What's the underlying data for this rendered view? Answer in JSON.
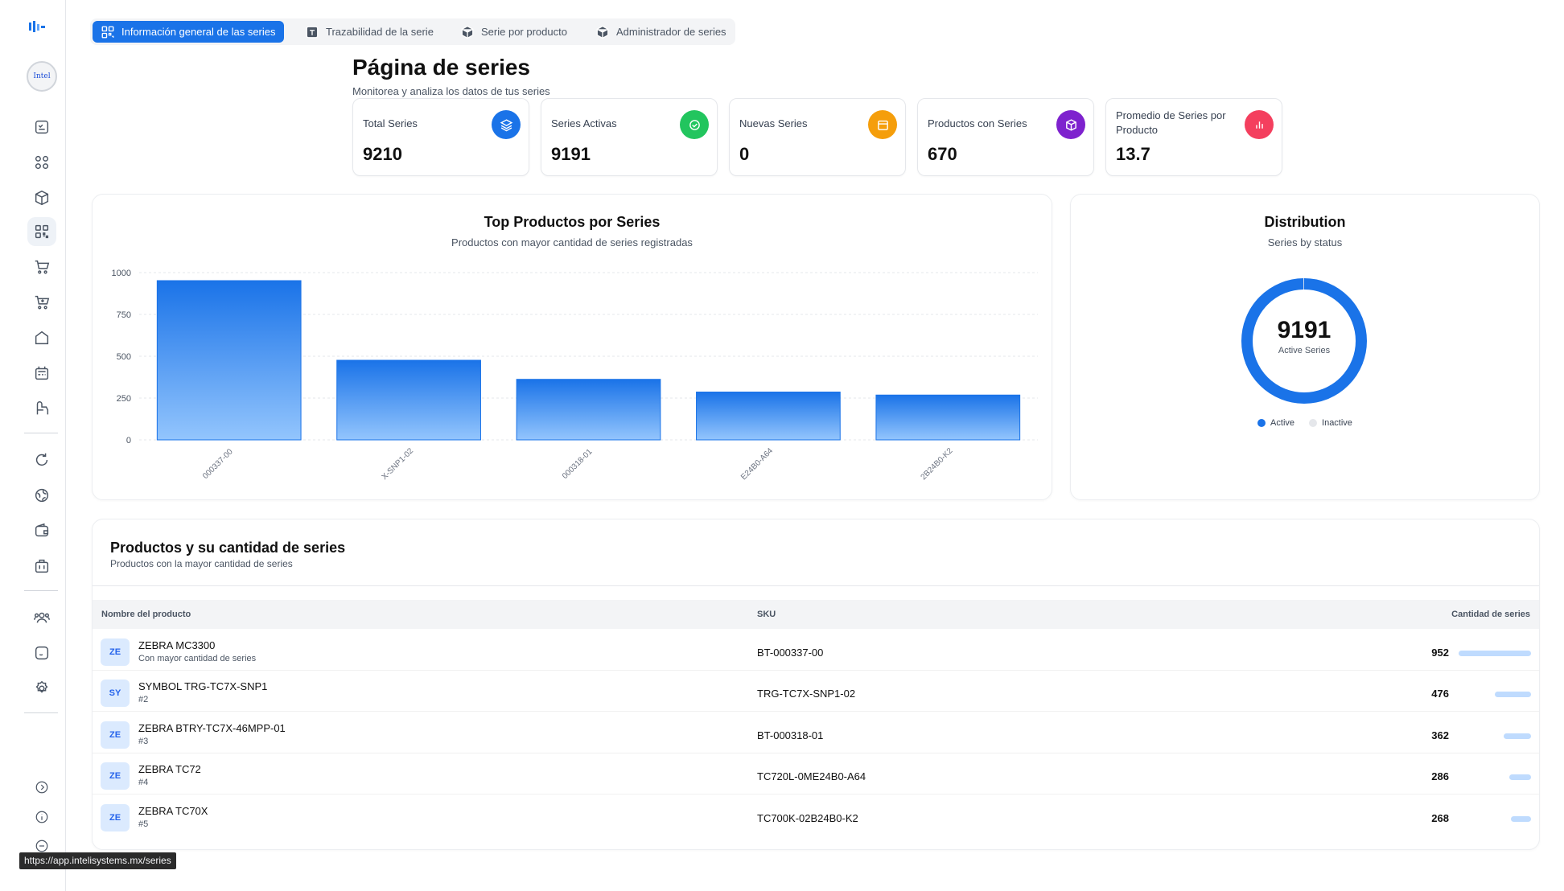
{
  "tabs": [
    {
      "label": "Información general de las series",
      "icon": "qr-code-icon"
    },
    {
      "label": "Trazabilidad de la serie",
      "icon": "box-icon"
    },
    {
      "label": "Serie por producto",
      "icon": "package-icon"
    },
    {
      "label": "Administrador de series",
      "icon": "package-icon"
    }
  ],
  "header": {
    "title": "Página de series",
    "subtitle": "Monitorea y analiza los datos de tus series"
  },
  "stats": [
    {
      "label": "Total Series",
      "value": "9210",
      "color": "#1a73e8",
      "icon": "layers-icon"
    },
    {
      "label": "Series Activas",
      "value": "9191",
      "color": "#22c55e",
      "icon": "check-circle-icon"
    },
    {
      "label": "Nuevas Series",
      "value": "0",
      "color": "#f59e0b",
      "icon": "calendar-icon"
    },
    {
      "label": "Productos con Series",
      "value": "670",
      "color": "#7e22ce",
      "icon": "cube-icon"
    },
    {
      "label": "Promedio de Series por Producto",
      "value": "13.7",
      "color": "#f43f5e",
      "icon": "bar-chart-icon"
    }
  ],
  "bar_panel": {
    "title": "Top Productos por Series",
    "subtitle": "Productos con mayor cantidad de series registradas"
  },
  "donut_panel": {
    "title": "Distribution",
    "subtitle": "Series by status",
    "center_value": "9191",
    "center_label": "Active Series",
    "legend": [
      {
        "label": "Active",
        "color": "#1a73e8"
      },
      {
        "label": "Inactive",
        "color": "#e5e7eb"
      }
    ]
  },
  "chart_data": [
    {
      "type": "bar",
      "title": "Top Productos por Series",
      "subtitle": "Productos con mayor cantidad de series registradas",
      "categories": [
        "000337-00",
        "X-SNP1-02",
        "000318-01",
        "E24B0-A64",
        "2B24B0-K2"
      ],
      "values": [
        952,
        476,
        362,
        286,
        268
      ],
      "yticks": [
        0,
        250,
        500,
        750,
        1000
      ],
      "ylim": [
        0,
        1000
      ],
      "grid": true,
      "color": "#1a73e8"
    },
    {
      "type": "pie",
      "title": "Distribution",
      "subtitle": "Series by status",
      "categories": [
        "Active",
        "Inactive"
      ],
      "values": [
        9191,
        19
      ],
      "colors": [
        "#1a73e8",
        "#e5e7eb"
      ]
    }
  ],
  "table": {
    "title": "Productos y su cantidad de series",
    "subtitle": "Productos con la mayor cantidad de series",
    "columns": [
      "Nombre del producto",
      "SKU",
      "Cantidad de series"
    ],
    "rows": [
      {
        "badge": "ZE",
        "name": "ZEBRA MC3300",
        "sub": "Con mayor cantidad de series",
        "sku": "BT-000337-00",
        "count": "952"
      },
      {
        "badge": "SY",
        "name": "SYMBOL TRG-TC7X-SNP1",
        "sub": "#2",
        "sku": "TRG-TC7X-SNP1-02",
        "count": "476"
      },
      {
        "badge": "ZE",
        "name": "ZEBRA BTRY-TC7X-46MPP-01",
        "sub": "#3",
        "sku": "BT-000318-01",
        "count": "362"
      },
      {
        "badge": "ZE",
        "name": "ZEBRA TC72",
        "sub": "#4",
        "sku": "TC720L-0ME24B0-A64",
        "count": "286"
      },
      {
        "badge": "ZE",
        "name": "ZEBRA TC70X",
        "sub": "#5",
        "sku": "TC700K-02B24B0-K2",
        "count": "268"
      }
    ],
    "bar_fractions": [
      1.0,
      0.5,
      0.38,
      0.3,
      0.28
    ]
  },
  "status_url": "https://app.intelisystems.mx/series",
  "sidebar": {
    "logo": "brand-logo",
    "avatar_text": "Intel"
  }
}
